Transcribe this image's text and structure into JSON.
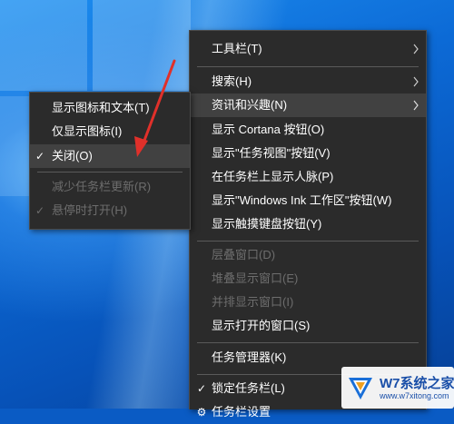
{
  "colors": {
    "menu_bg": "#2b2b2b",
    "highlight": "#414141",
    "disabled_text": "#6d6d6d",
    "desktop_blue": "#0a5bc4",
    "arrow": "#e0302a"
  },
  "main_menu": {
    "items": [
      {
        "label": "工具栏(T)",
        "submenu": true
      },
      {
        "label": "搜索(H)",
        "submenu": true
      },
      {
        "label": "资讯和兴趣(N)",
        "submenu": true,
        "highlighted": true
      },
      {
        "label": "显示 Cortana 按钮(O)"
      },
      {
        "label": "显示\"任务视图\"按钮(V)"
      },
      {
        "label": "在任务栏上显示人脉(P)"
      },
      {
        "label": "显示\"Windows Ink 工作区\"按钮(W)"
      },
      {
        "label": "显示触摸键盘按钮(Y)"
      },
      {
        "label": "层叠窗口(D)",
        "disabled": true
      },
      {
        "label": "堆叠显示窗口(E)",
        "disabled": true
      },
      {
        "label": "并排显示窗口(I)",
        "disabled": true
      },
      {
        "label": "显示打开的窗口(S)"
      },
      {
        "label": "任务管理器(K)"
      },
      {
        "label": "锁定任务栏(L)",
        "checked": true
      },
      {
        "label": "任务栏设置"
      }
    ]
  },
  "sub_menu": {
    "items": [
      {
        "label": "显示图标和文本(T)"
      },
      {
        "label": "仅显示图标(I)"
      },
      {
        "label": "关闭(O)",
        "checked": true,
        "highlighted": true
      },
      {
        "label": "减少任务栏更新(R)",
        "disabled": true
      },
      {
        "label": "悬停时打开(H)",
        "disabled": true,
        "checked": true
      }
    ]
  },
  "check_glyph": "✓",
  "watermark": {
    "text": "W7系统之家",
    "url": "www.w7xitong.com"
  }
}
